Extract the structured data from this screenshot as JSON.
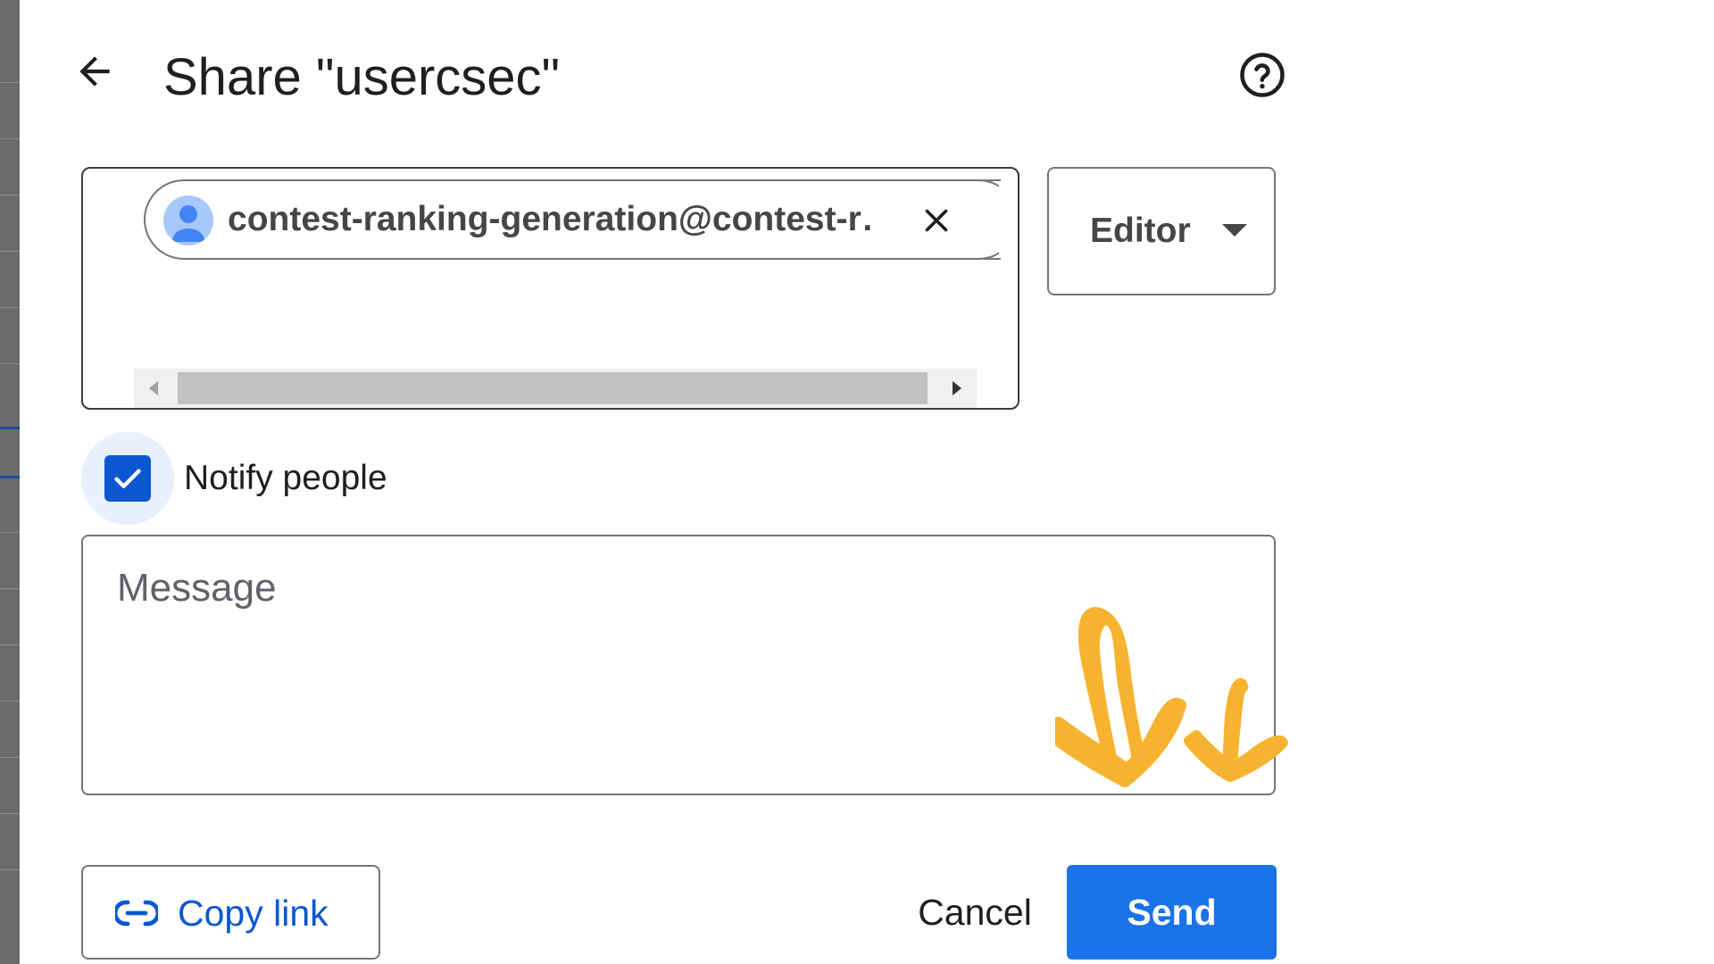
{
  "dialog": {
    "title": "Share \"usercsec\"",
    "back_icon": "arrow-left-icon",
    "help_icon": "help-circle-icon"
  },
  "recipients": {
    "chips": [
      {
        "label": "contest-ranking-generation@contest-r…",
        "avatar_icon": "person-icon",
        "remove_icon": "close-icon"
      }
    ]
  },
  "role": {
    "label": "Editor",
    "caret_icon": "caret-down-icon"
  },
  "notify": {
    "label": "Notify people",
    "checked": true
  },
  "message": {
    "placeholder": "Message",
    "value": ""
  },
  "footer": {
    "copy_link_label": "Copy link",
    "copy_link_icon": "link-icon",
    "cancel_label": "Cancel",
    "send_label": "Send"
  },
  "colors": {
    "primary": "#1a73e8",
    "checkbox": "#0b57d0",
    "link_text": "#0b57d0",
    "annotation": "#f6b330"
  }
}
